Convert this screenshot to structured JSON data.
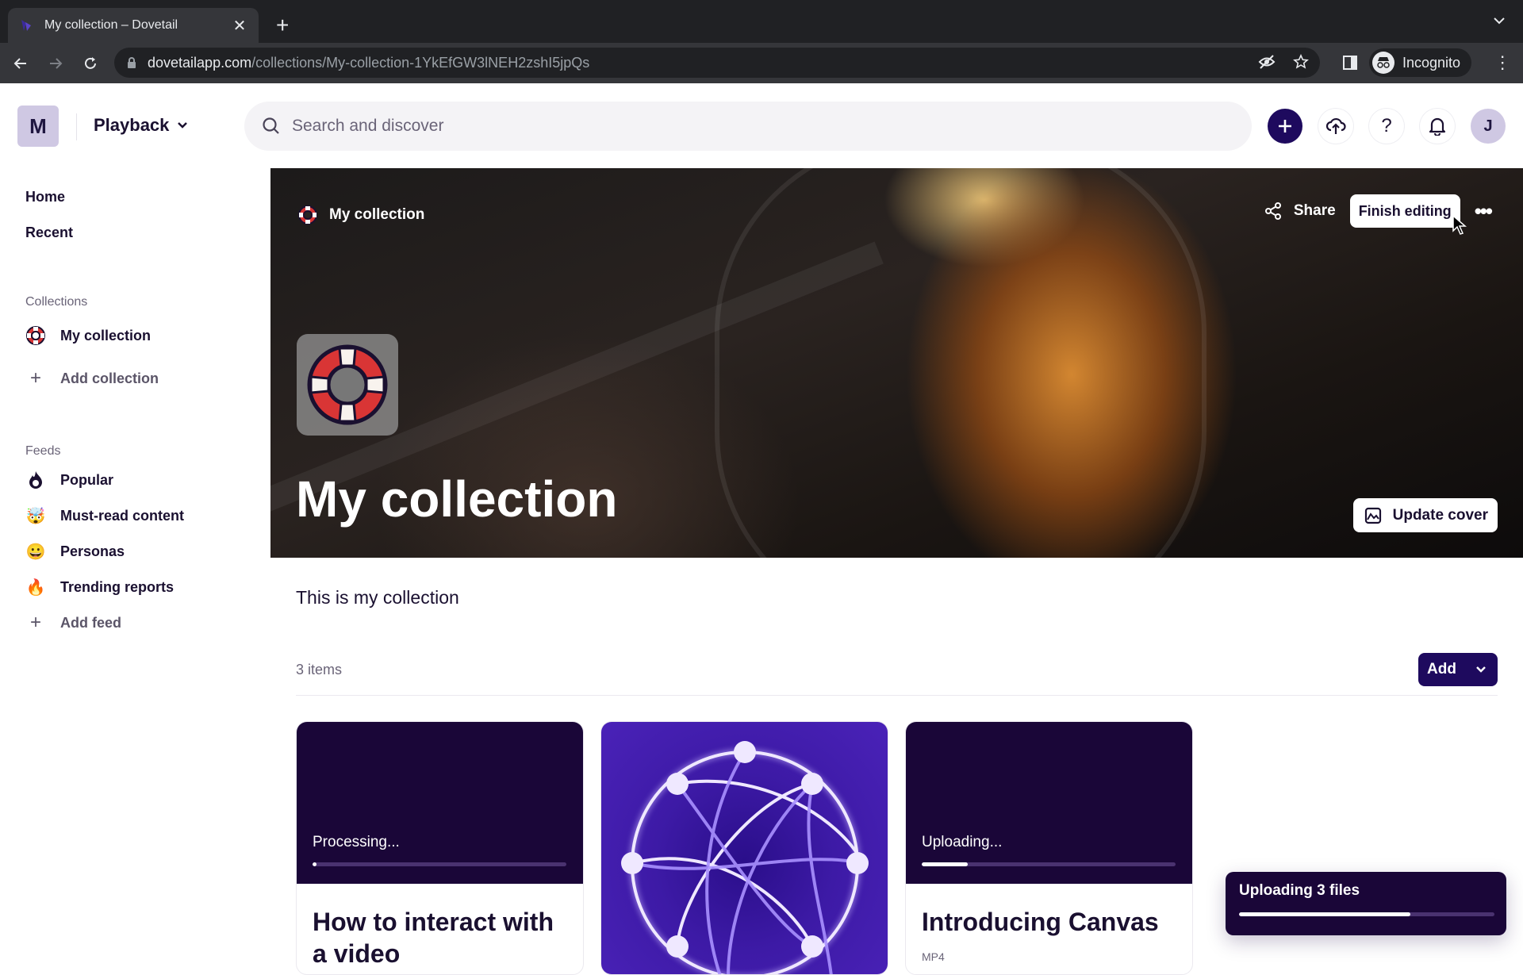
{
  "browser": {
    "tab_title": "My collection – Dovetail",
    "url_host": "dovetailapp.com",
    "url_path": "/collections/My-collection-1YkEfGW3lNEH2zshI5jpQs",
    "profile_label": "Incognito"
  },
  "header": {
    "workspace_initial": "M",
    "workspace_name": "Playback",
    "search_placeholder": "Search and discover",
    "user_initial": "J"
  },
  "sidebar": {
    "nav": [
      {
        "label": "Home"
      },
      {
        "label": "Recent"
      }
    ],
    "collections_label": "Collections",
    "collections": [
      {
        "label": "My collection",
        "icon": "lifebuoy-icon"
      }
    ],
    "add_collection_label": "Add collection",
    "feeds_label": "Feeds",
    "feeds": [
      {
        "label": "Popular",
        "icon": "flame-outline-icon",
        "glyph": ""
      },
      {
        "label": "Must-read content",
        "icon": "mind-blown-emoji-icon",
        "glyph": "🤯"
      },
      {
        "label": "Personas",
        "icon": "grinning-emoji-icon",
        "glyph": "😀"
      },
      {
        "label": "Trending reports",
        "icon": "fire-emoji-icon",
        "glyph": "🔥"
      }
    ],
    "add_feed_label": "Add feed"
  },
  "hero": {
    "breadcrumb": "My collection",
    "share_label": "Share",
    "finish_editing_label": "Finish editing",
    "title": "My collection",
    "update_cover_label": "Update cover"
  },
  "main": {
    "description": "This is my collection",
    "items_count": "3 items",
    "add_label": "Add",
    "cards": [
      {
        "status": "Processing...",
        "progress": 0.01,
        "title": "How to interact with a video",
        "meta": ""
      },
      {
        "status": "",
        "progress": null,
        "title": "",
        "meta": ""
      },
      {
        "status": "Uploading...",
        "progress": 0.18,
        "title": "Introducing Canvas",
        "meta": "MP4"
      }
    ]
  },
  "toast": {
    "title": "Uploading 3 files",
    "progress": 0.67
  },
  "colors": {
    "brand": "#1e0a5e",
    "card_dark": "#1a0638",
    "avatar_bg": "#cfc8e3"
  }
}
